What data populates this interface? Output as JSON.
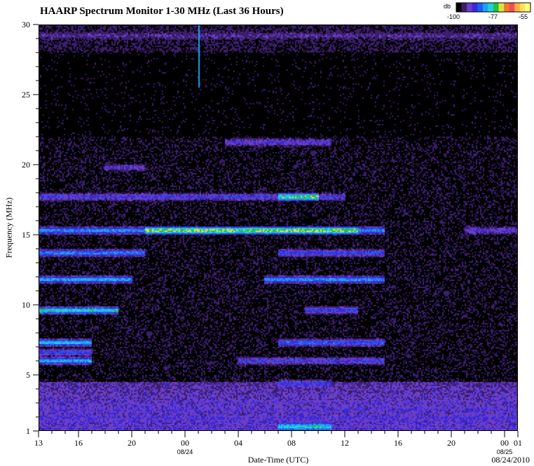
{
  "chart_data": {
    "type": "heatmap",
    "title": "HAARP Spectrum Monitor 1-30 MHz (Last 36 Hours)",
    "xlabel": "Date-Time (UTC)",
    "ylabel": "Frequency (MHz)",
    "x_ticks": [
      {
        "label": "13",
        "hour": 0
      },
      {
        "label": "16",
        "hour": 3
      },
      {
        "label": "20",
        "hour": 7
      },
      {
        "label": "00",
        "hour": 11,
        "date": "08/24"
      },
      {
        "label": "04",
        "hour": 15
      },
      {
        "label": "08",
        "hour": 19
      },
      {
        "label": "12",
        "hour": 23
      },
      {
        "label": "16",
        "hour": 27
      },
      {
        "label": "20",
        "hour": 31
      },
      {
        "label": "00",
        "hour": 35,
        "date": "08/25"
      },
      {
        "label": "01",
        "hour": 36
      }
    ],
    "xlim": [
      0,
      36
    ],
    "y_ticks": [
      1,
      5,
      10,
      15,
      20,
      25,
      30
    ],
    "ylim": [
      1,
      30
    ],
    "date_label": "08/24/2010",
    "colorbar": {
      "unit": "db",
      "min_label": "-100",
      "mid_label": "-77",
      "max_label": "-55",
      "range": [
        -100,
        -55
      ],
      "colors": [
        "#000000",
        "#3c1e6e",
        "#6a3fc8",
        "#3a28d8",
        "#1e5cf0",
        "#1ea0f0",
        "#20d0e0",
        "#20c040",
        "#e0e040",
        "#f07830",
        "#f05050",
        "#ffb040",
        "#ffe060",
        "#ffff80"
      ]
    },
    "bands": [
      {
        "freq_mhz": 1.3,
        "hours": [
          0,
          36
        ],
        "level_db": -88
      },
      {
        "freq_mhz": 1.3,
        "hours": [
          18,
          22
        ],
        "level_db": -70
      },
      {
        "freq_mhz": 1.9,
        "hours": [
          0,
          36
        ],
        "level_db": -86
      },
      {
        "freq_mhz": 2.5,
        "hours": [
          0,
          36
        ],
        "level_db": -87
      },
      {
        "freq_mhz": 3.0,
        "hours": [
          0,
          36
        ],
        "level_db": -88
      },
      {
        "freq_mhz": 3.5,
        "hours": [
          0,
          36
        ],
        "level_db": -90
      },
      {
        "freq_mhz": 4.0,
        "hours": [
          0,
          36
        ],
        "level_db": -92
      },
      {
        "freq_mhz": 4.4,
        "hours": [
          18,
          22
        ],
        "level_db": -82
      },
      {
        "freq_mhz": 6.0,
        "hours": [
          0,
          4
        ],
        "level_db": -72
      },
      {
        "freq_mhz": 6.0,
        "hours": [
          15,
          26
        ],
        "level_db": -82
      },
      {
        "freq_mhz": 6.6,
        "hours": [
          0,
          4
        ],
        "level_db": -80
      },
      {
        "freq_mhz": 7.3,
        "hours": [
          0,
          4
        ],
        "level_db": -70
      },
      {
        "freq_mhz": 7.3,
        "hours": [
          18,
          26
        ],
        "level_db": -78
      },
      {
        "freq_mhz": 9.6,
        "hours": [
          0,
          6
        ],
        "level_db": -68
      },
      {
        "freq_mhz": 9.6,
        "hours": [
          20,
          24
        ],
        "level_db": -80
      },
      {
        "freq_mhz": 11.8,
        "hours": [
          0,
          7
        ],
        "level_db": -72
      },
      {
        "freq_mhz": 11.8,
        "hours": [
          17,
          26
        ],
        "level_db": -74
      },
      {
        "freq_mhz": 13.7,
        "hours": [
          0,
          8
        ],
        "level_db": -76
      },
      {
        "freq_mhz": 13.7,
        "hours": [
          18,
          26
        ],
        "level_db": -80
      },
      {
        "freq_mhz": 15.3,
        "hours": [
          0,
          26
        ],
        "level_db": -74
      },
      {
        "freq_mhz": 15.3,
        "hours": [
          8,
          24
        ],
        "level_db": -66
      },
      {
        "freq_mhz": 15.3,
        "hours": [
          32,
          36
        ],
        "level_db": -84
      },
      {
        "freq_mhz": 17.7,
        "hours": [
          0,
          23
        ],
        "level_db": -82
      },
      {
        "freq_mhz": 17.7,
        "hours": [
          18,
          21
        ],
        "level_db": -66
      },
      {
        "freq_mhz": 19.8,
        "hours": [
          5,
          8
        ],
        "level_db": -86
      },
      {
        "freq_mhz": 21.6,
        "hours": [
          14,
          22
        ],
        "level_db": -84
      },
      {
        "freq_mhz": 29.2,
        "hours": [
          0,
          36
        ],
        "level_db": -90
      }
    ]
  }
}
